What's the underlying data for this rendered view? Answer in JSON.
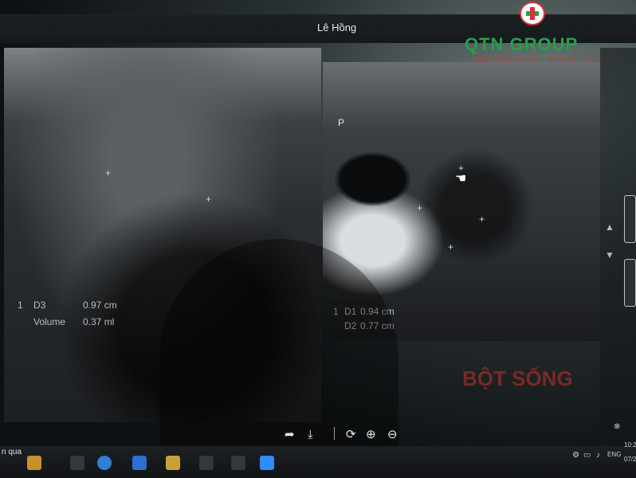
{
  "window": {
    "title": "Lê Hồng"
  },
  "brand": {
    "name": "QTN GROUP",
    "tagline": "BỆNH VIỆN AN TÂM - NIỀM VUI LAN TỎA",
    "colors": {
      "green": "#22a14b",
      "red": "#d7323b"
    }
  },
  "left_image": {
    "line1_index": "1",
    "line1_label": "D3",
    "line1_value": "0.97 cm",
    "line2_label": "Volume",
    "line2_value": "0.37 ml"
  },
  "right_image": {
    "marker": "P",
    "line1_index": "1",
    "line1_label": "D1",
    "line1_value": "0.94 cm",
    "line2_label": "D2",
    "line2_value": "0.77 cm"
  },
  "toolbar": {
    "icons": [
      "share-icon",
      "download-icon",
      "rotate-icon",
      "zoom-in-icon",
      "zoom-out-icon"
    ]
  },
  "taskbar": {
    "left_text": "n qua",
    "lang": "ENG",
    "time": "10:2",
    "date": "07/2"
  },
  "background_poster": {
    "text": "BỘT SỐNG"
  }
}
